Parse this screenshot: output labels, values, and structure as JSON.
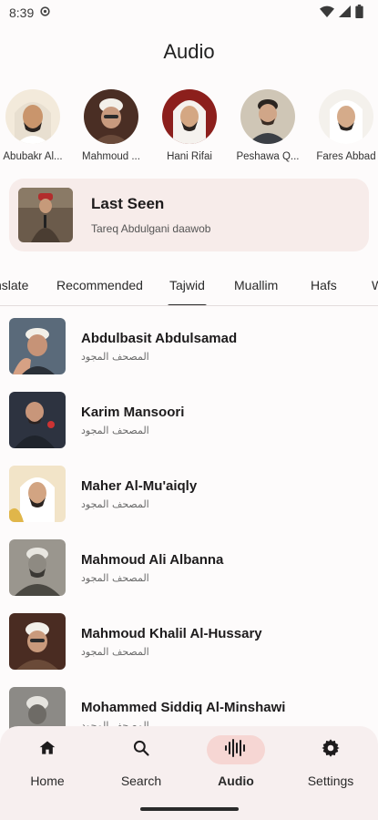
{
  "status": {
    "time": "8:39"
  },
  "title": "Audio",
  "reciters": [
    {
      "name": "Abubakr Al..."
    },
    {
      "name": "Mahmoud ..."
    },
    {
      "name": "Hani Rifai"
    },
    {
      "name": "Peshawa Q..."
    },
    {
      "name": "Fares Abbad"
    }
  ],
  "last_seen": {
    "title": "Last Seen",
    "subtitle": "Tareq Abdulgani daawob"
  },
  "tabs": [
    {
      "label": "nslate"
    },
    {
      "label": "Recommended"
    },
    {
      "label": "Tajwid"
    },
    {
      "label": "Muallim"
    },
    {
      "label": "Hafs"
    },
    {
      "label": "W"
    }
  ],
  "active_tab": "Tajwid",
  "list": [
    {
      "name": "Abdulbasit Abdulsamad",
      "subtitle": "المصحف المجود"
    },
    {
      "name": "Karim Mansoori",
      "subtitle": "المصحف المجود"
    },
    {
      "name": "Maher Al-Mu'aiqly",
      "subtitle": "المصحف المجود"
    },
    {
      "name": "Mahmoud Ali Albanna",
      "subtitle": "المصحف المجود"
    },
    {
      "name": "Mahmoud Khalil Al-Hussary",
      "subtitle": "المصحف المجود"
    },
    {
      "name": "Mohammed Siddiq Al-Minshawi",
      "subtitle": "المصحف المجود"
    }
  ],
  "nav": [
    {
      "label": "Home",
      "icon": "home-icon"
    },
    {
      "label": "Search",
      "icon": "search-icon"
    },
    {
      "label": "Audio",
      "icon": "audio-waveform-icon"
    },
    {
      "label": "Settings",
      "icon": "gear-icon"
    }
  ],
  "active_nav": "Audio",
  "colors": {
    "background": "#fdfbfb",
    "card": "#f7ecea",
    "nav_bar": "#f7efef",
    "nav_active_pill": "#f6d6d3"
  }
}
